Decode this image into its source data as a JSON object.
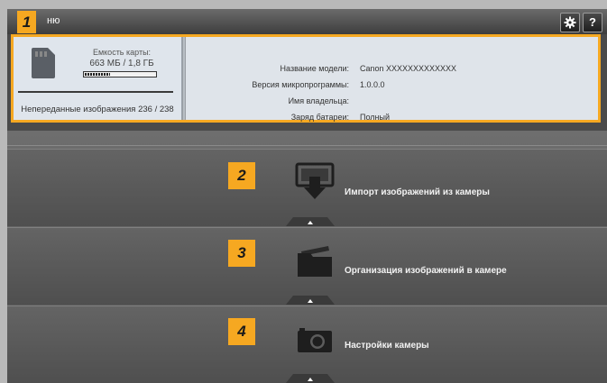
{
  "titlebar": {
    "title": "ню",
    "settings_icon": "gear-icon",
    "help_label": "?"
  },
  "badges": [
    "1",
    "2",
    "3",
    "4"
  ],
  "card": {
    "icon": "sd-card-icon",
    "capacity_label": "Емкость карты:",
    "capacity_value": "663 МБ / 1,8 ГБ",
    "capacity_used_fraction": 0.36,
    "untransferred": "Непереданные изображения 236 / 238"
  },
  "camera_info": [
    {
      "label": "Название модели:",
      "value": "Canon  XXXXXXXXXXXXX"
    },
    {
      "label": "Версия микропрограммы:",
      "value": "1.0.0.0"
    },
    {
      "label": "Имя владельца:",
      "value": ""
    },
    {
      "label": "Заряд батареи:",
      "value": "Полный"
    }
  ],
  "menu": [
    {
      "label": "Импорт изображений из камеры",
      "icon": "import-icon"
    },
    {
      "label": "Организация изображений в камере",
      "icon": "folder-icon"
    },
    {
      "label": "Настройки камеры",
      "icon": "camera-icon"
    }
  ],
  "colors": {
    "accent": "#f6a821",
    "panel_bg": "#dfe4ea",
    "menu_bg": "#5c5c5c"
  }
}
